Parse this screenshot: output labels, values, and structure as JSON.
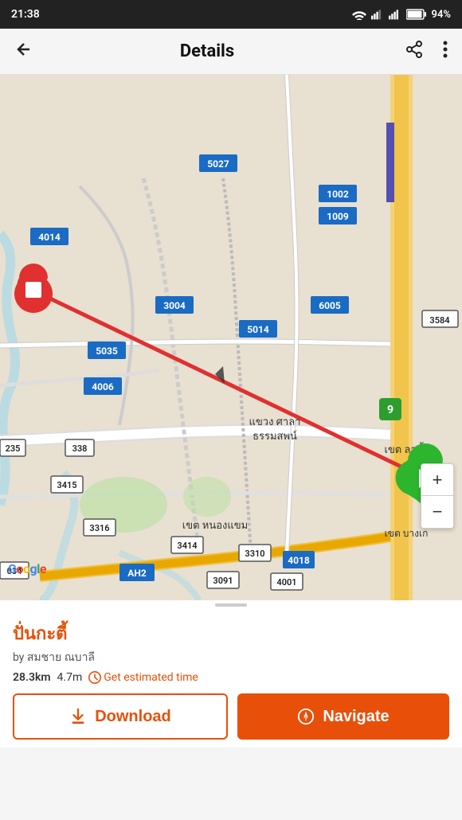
{
  "statusBar": {
    "time": "21:38",
    "battery": "94%"
  },
  "navBar": {
    "title": "Details",
    "backLabel": "←",
    "shareLabel": "share",
    "menuLabel": "more"
  },
  "map": {
    "roadNumbers": [
      "5027",
      "1002",
      "1009",
      "4014",
      "3004",
      "6005",
      "5014",
      "3584",
      "5035",
      "4006",
      "235",
      "338",
      "3415",
      "3316",
      "3414",
      "3310",
      "034",
      "AH2",
      "3091",
      "4018",
      "4001"
    ],
    "areaLabels": [
      "แขวง ศาลา ธรรมสพน์",
      "เขต ลาดี้ง",
      "เขต บางเก",
      "เขต หนองแขม"
    ]
  },
  "routeInfo": {
    "name": "ปั่นกะตี้",
    "author": "by สมชาย ณบาลี",
    "distance": "28.3km",
    "time": "4.7m",
    "getTimeLabel": "Get estimated time"
  },
  "buttons": {
    "download": "Download",
    "navigate": "Navigate"
  },
  "zoom": {
    "plus": "+",
    "minus": "−"
  }
}
